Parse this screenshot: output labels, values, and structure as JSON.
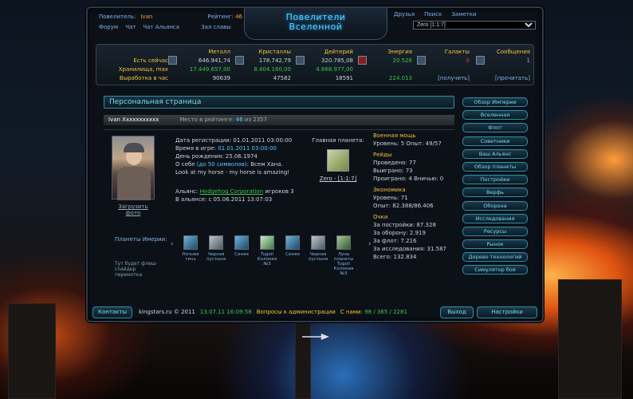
{
  "header": {
    "ruler_label": "Повелитель:",
    "ruler_name": "Ivan",
    "rating_label": "Рейтинг:",
    "rating_value": "46",
    "nav": [
      "Форум",
      "Чат",
      "Чат Альянса",
      "Зал славы"
    ],
    "logo_line1": "Повелители",
    "logo_line2": "Вселенной",
    "top_menu": [
      "Друзья",
      "Поиск",
      "Заметки"
    ],
    "planet_select": "Zero [1:1:7]"
  },
  "resources": {
    "row_labels": [
      "Есть сейчас",
      "Хранилища, max",
      "Выработка в час"
    ],
    "columns": [
      {
        "title": "Металл",
        "values": [
          "646.941,74",
          "17.449.657,00",
          "90639"
        ],
        "icon": "metal-icon"
      },
      {
        "title": "Кристаллы",
        "values": [
          "178.742,79",
          "8.404.160,00",
          "47582"
        ],
        "icon": "crystal-icon"
      },
      {
        "title": "Дейтерий",
        "values": [
          "320.785,08",
          "4.668.977,00",
          "18591"
        ],
        "icon": "deuterium-icon"
      },
      {
        "title": "Энергия",
        "values": [
          "20.526",
          "",
          "224.013"
        ],
        "icon": "energy-icon"
      },
      {
        "title": "Галакты",
        "values": [
          "0",
          "",
          "[получить]"
        ],
        "icon": "galactics-icon"
      },
      {
        "title": "Сообщения",
        "values": [
          "1",
          "",
          "[прочитать]"
        ],
        "icon": "messages-icon"
      }
    ]
  },
  "page": {
    "title": "Персональная страница",
    "username": "Ivan Xxxxxxxxxxx",
    "place_label": "Место в рейтинге:",
    "place_value": "46",
    "place_of": "из 2357",
    "upload_photo": "Загрузить фото",
    "reg_date": "Дата регистрации: 01.01.2011 03:00:00",
    "game_time_label": "Время в игре:",
    "game_time": "01.01.2011 03:00:00",
    "birthday": "День рождения: 25.06.1974",
    "about_label": "О себе",
    "about_limit": "(до 50 символов)",
    "about_text": ": Всем Хана.",
    "about_text2": "Look at my horse - my horse is amazing!",
    "alliance_label": "Альянс:",
    "alliance_name": "Hedgehog Corporation",
    "alliance_players": "игроков 3",
    "alliance_since": "В альянсе: с 05.06.2011 13:07:03",
    "home_planet_label": "Главная планета:",
    "home_planet": "Zero - [1:1:7]"
  },
  "stats": {
    "military_h": "Военная мощь",
    "military": "Уровень: 5 Опыт: 49/57",
    "raids_h": "Рейды",
    "raids": [
      "Проведено: 77",
      "Выиграно: 73",
      "Проиграно: 4 Вничью: 0"
    ],
    "economy_h": "Экономика",
    "economy": [
      "Уровень: 71",
      "Опыт: 82.388/86.406"
    ],
    "points_h": "Очки",
    "points": [
      "За постройки: 87.328",
      "За оборону: 2.919",
      "За флот: 7.216",
      "За исследования: 31.587",
      "Всего: 132.834"
    ]
  },
  "gallery": {
    "label": "Планеты Имерии:",
    "placeholder": "Тут будет флеш-слайдер перемотка",
    "items": [
      "Ночная тень",
      "Черная пустыня",
      "Синяя",
      "Tugoil Колония №3",
      "Синяя",
      "Черная пустыня",
      "Луна планеты Tugoil Колония №3"
    ]
  },
  "side_menu": [
    "Обзор Империи",
    "Вселенная",
    "Флот",
    "Советники",
    "Ваш Альянс",
    "Обзор планеты",
    "Постройки",
    "Верфь",
    "Оборона",
    "Исследования",
    "Ресурсы",
    "Рынок",
    "Дерево технологий",
    "Симулятор боя"
  ],
  "footer": {
    "contacts": "Контакты",
    "copyright": "kingstars.ru © 2011",
    "datetime": "13.07.11 16:09:58",
    "questions": "Вопросы к администрации",
    "with_us_label": "С нами:",
    "with_us": "98 / 365 / 2281",
    "exit": "Выход",
    "settings": "Настройки"
  }
}
